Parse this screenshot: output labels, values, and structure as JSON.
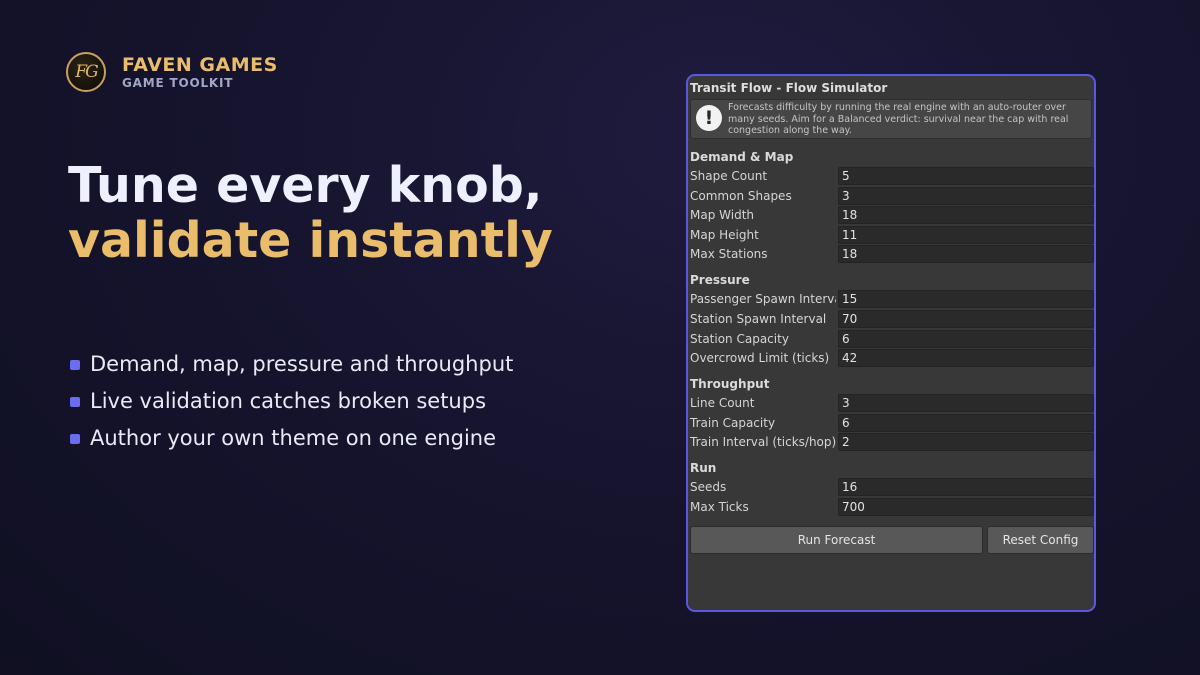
{
  "brand": {
    "logo_text": "FG",
    "name": "FAVEN GAMES",
    "subtitle": "GAME TOOLKIT"
  },
  "headline": {
    "line1": "Tune every knob,",
    "line2": "validate instantly"
  },
  "bullets": [
    "Demand, map, pressure and throughput",
    "Live validation catches broken setups",
    "Author your own theme on one engine"
  ],
  "panel": {
    "title": "Transit Flow - Flow Simulator",
    "help_icon": "exclamation-icon",
    "help_text": "Forecasts difficulty by running the real engine with an auto-router over many seeds. Aim for a Balanced verdict: survival near the cap with real congestion along the way.",
    "sections": {
      "demand": {
        "header": "Demand & Map",
        "fields": [
          {
            "label": "Shape Count",
            "value": "5"
          },
          {
            "label": "Common Shapes",
            "value": "3"
          },
          {
            "label": "Map Width",
            "value": "18"
          },
          {
            "label": "Map Height",
            "value": "11"
          },
          {
            "label": "Max Stations",
            "value": "18"
          }
        ]
      },
      "pressure": {
        "header": "Pressure",
        "fields": [
          {
            "label": "Passenger Spawn Interval",
            "value": "15"
          },
          {
            "label": "Station Spawn Interval",
            "value": "70"
          },
          {
            "label": "Station Capacity",
            "value": "6"
          },
          {
            "label": "Overcrowd Limit (ticks)",
            "value": "42"
          }
        ]
      },
      "throughput": {
        "header": "Throughput",
        "fields": [
          {
            "label": "Line Count",
            "value": "3"
          },
          {
            "label": "Train Capacity",
            "value": "6"
          },
          {
            "label": "Train Interval (ticks/hop)",
            "value": "2"
          }
        ]
      },
      "run": {
        "header": "Run",
        "fields": [
          {
            "label": "Seeds",
            "value": "16"
          },
          {
            "label": "Max Ticks",
            "value": "700"
          }
        ]
      }
    },
    "buttons": {
      "run": "Run Forecast",
      "reset": "Reset Config"
    }
  },
  "colors": {
    "accent_gold": "#e9bd6b",
    "accent_purple": "#5b57e0",
    "bullet": "#6b6df0"
  }
}
